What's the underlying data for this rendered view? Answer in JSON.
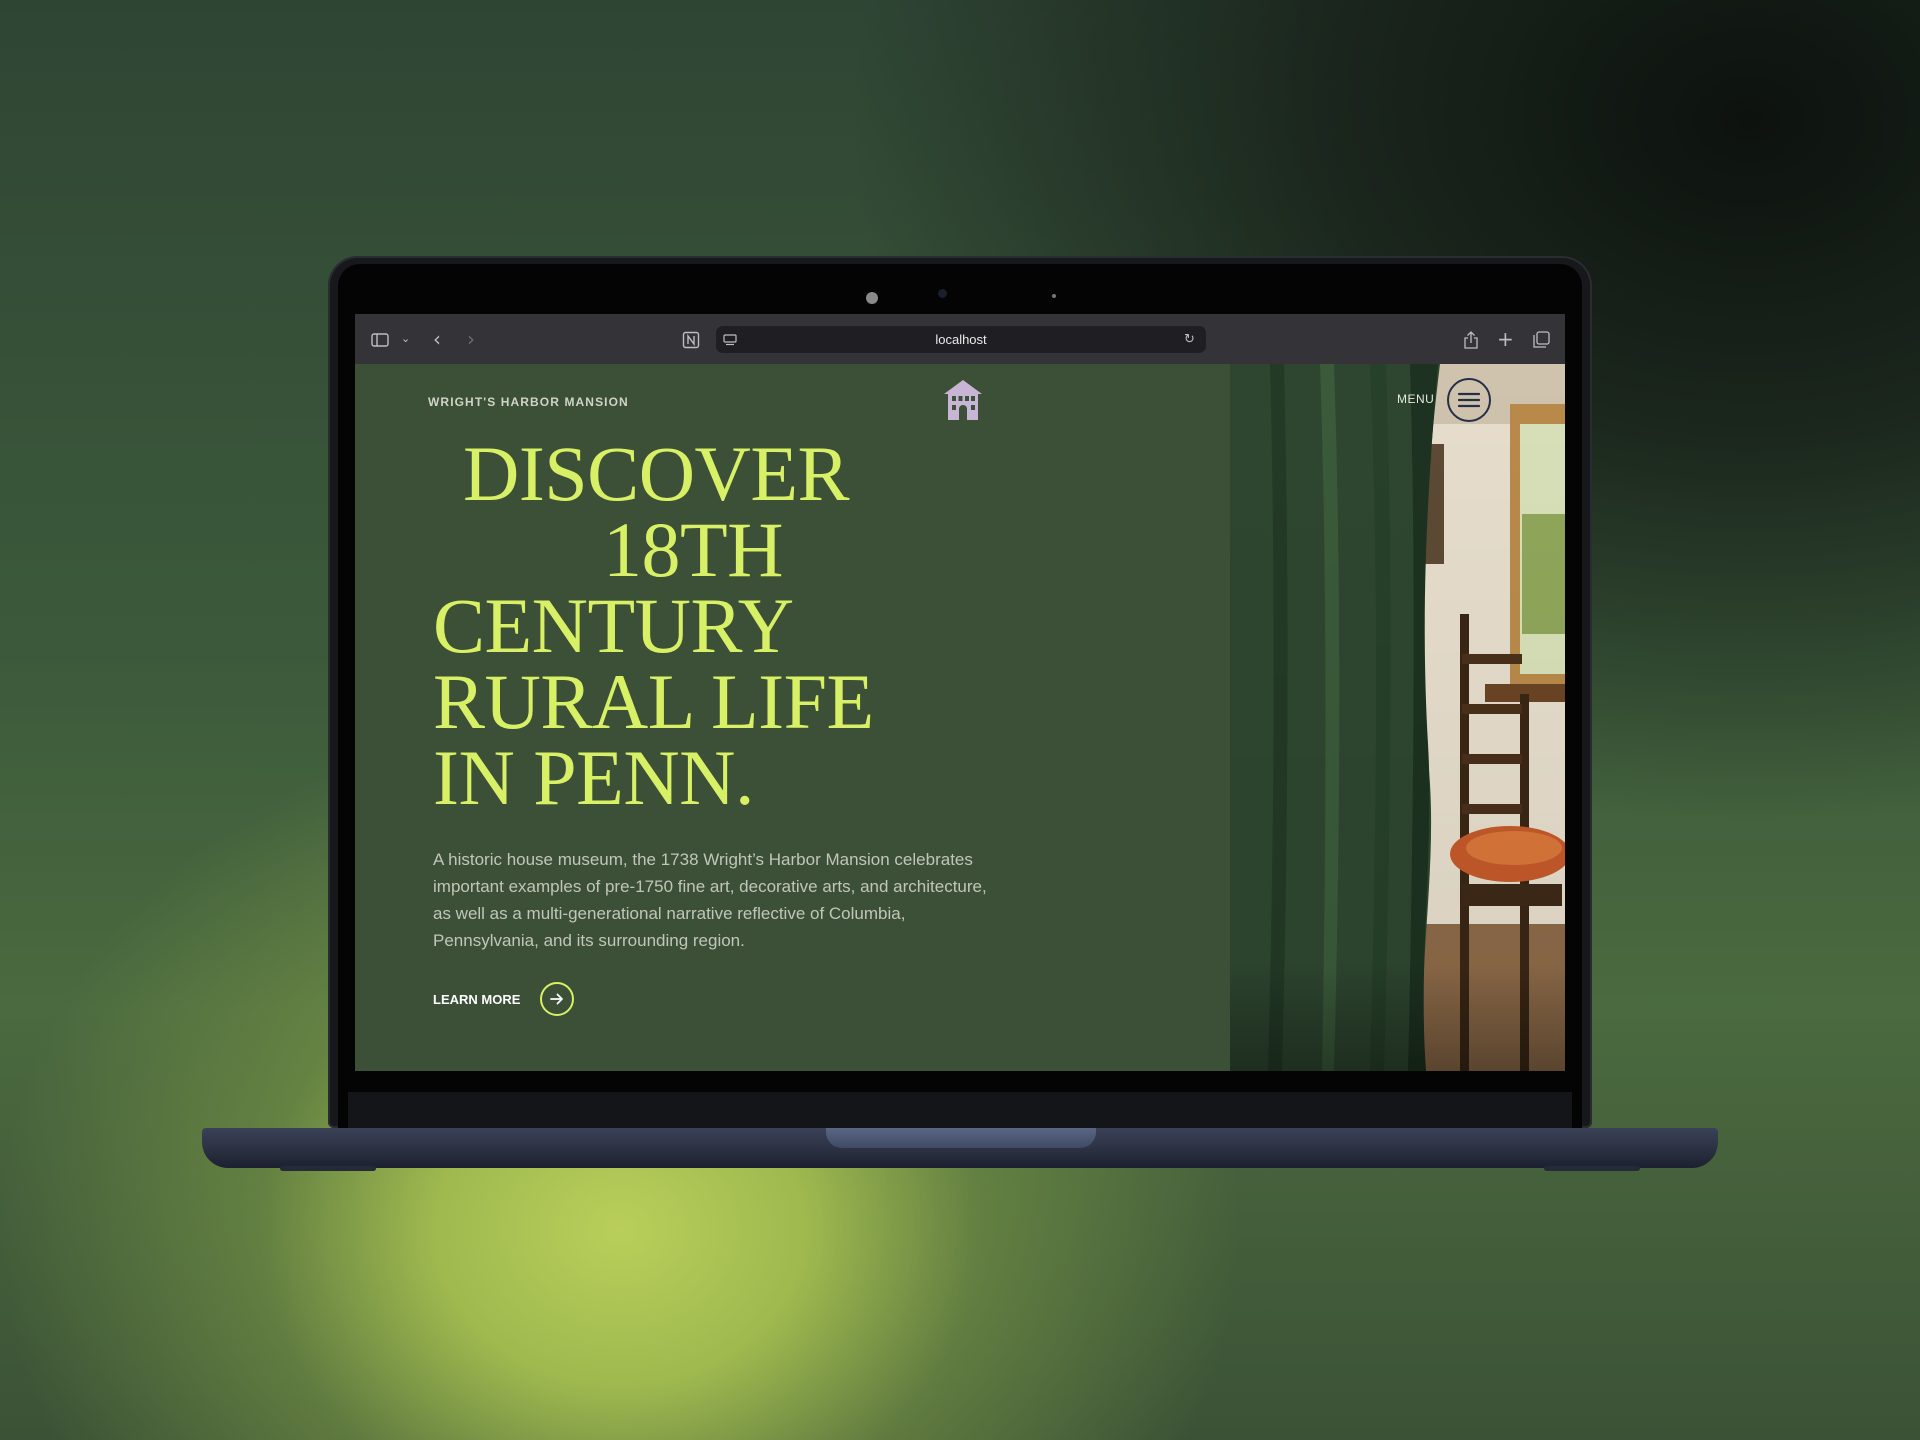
{
  "browser": {
    "url": "localhost",
    "icons": [
      "sidebar-icon",
      "chevron-down-icon",
      "back-icon",
      "forward-icon",
      "notion-extension-icon",
      "page-settings-icon",
      "reload-icon",
      "share-icon",
      "new-tab-icon",
      "tabs-overview-icon"
    ]
  },
  "site": {
    "title": "WRIGHT'S HARBOR MANSION",
    "logo_icon": "house-icon",
    "menu_label": "MENU",
    "menu_icon": "hamburger-icon"
  },
  "hero": {
    "headline": [
      "DISCOVER",
      "18TH",
      "CENTURY",
      "RURAL LIFE",
      "IN PENN."
    ],
    "description": "A historic house museum, the 1738 Wright’s Harbor Mansion celebrates important examples of pre-1750 fine art, decorative arts, and architecture, as well as a multi-generational narrative reflective of Columbia, Pennsylvania, and its surrounding region.",
    "cta_label": "LEARN MORE",
    "cta_icon": "arrow-right-icon"
  },
  "colors": {
    "page_bg": "#3c4f37",
    "headline": "#d8f065",
    "logo": "#c8b4d4"
  }
}
